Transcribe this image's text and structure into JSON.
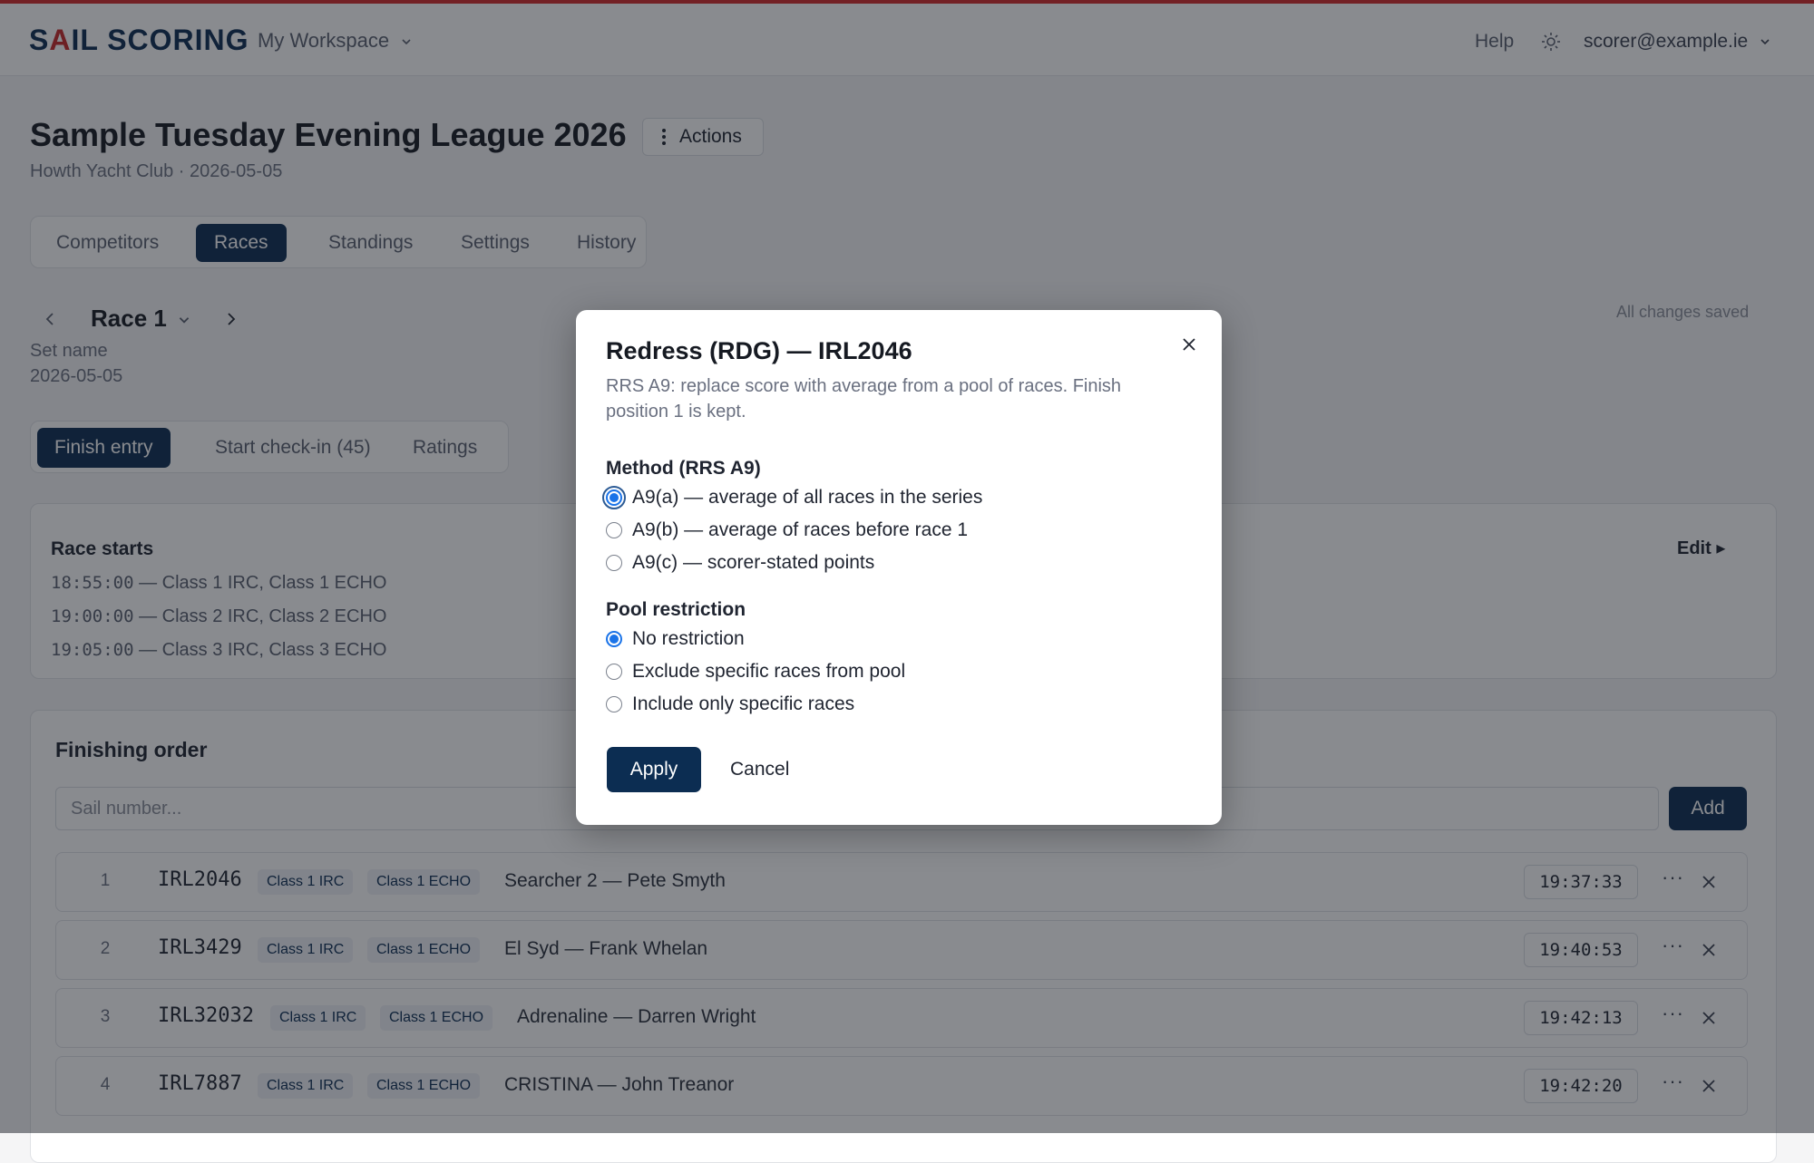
{
  "app": {
    "logo_prefix": "S",
    "logo_accent": "A",
    "logo_rest": "IL SCORING",
    "workspace": "My Workspace",
    "help": "Help",
    "user": "scorer@example.ie",
    "accent_color": "#d32a2a",
    "brand_color": "#0c2d52"
  },
  "event": {
    "title": "Sample Tuesday Evening League 2026",
    "actions_label": "Actions",
    "subtitle": "Howth Yacht Club · 2026-05-05"
  },
  "tabs": [
    {
      "label": "Competitors"
    },
    {
      "label": "Races"
    },
    {
      "label": "Standings"
    },
    {
      "label": "Settings"
    },
    {
      "label": "History"
    }
  ],
  "race": {
    "title": "Race 1",
    "set_name": "Set name",
    "date": "2026-05-05",
    "saved_status": "All changes saved"
  },
  "subtabs": [
    {
      "label": "Finish entry"
    },
    {
      "label": "Start check-in (45)"
    },
    {
      "label": "Ratings"
    }
  ],
  "race_starts": {
    "title": "Race starts",
    "edit_label": "Edit ▸",
    "lines": [
      {
        "time": "18:55:00",
        "classes": " — Class 1 IRC, Class 1 ECHO"
      },
      {
        "time": "19:00:00",
        "classes": " — Class 2 IRC, Class 2 ECHO"
      },
      {
        "time": "19:05:00",
        "classes": " — Class 3 IRC, Class 3 ECHO"
      }
    ]
  },
  "finishing": {
    "title": "Finishing order",
    "placeholder": "Sail number...",
    "add_label": "Add",
    "rows": [
      {
        "pos": "1",
        "sail": "IRL2046",
        "badge1": "Class 1 IRC",
        "badge2": "Class 1 ECHO",
        "boat": "Searcher 2 — Pete Smyth",
        "time": "19:37:33"
      },
      {
        "pos": "2",
        "sail": "IRL3429",
        "badge1": "Class 1 IRC",
        "badge2": "Class 1 ECHO",
        "boat": "El Syd — Frank Whelan",
        "time": "19:40:53"
      },
      {
        "pos": "3",
        "sail": "IRL32032",
        "badge1": "Class 1 IRC",
        "badge2": "Class 1 ECHO",
        "boat": "Adrenaline — Darren Wright",
        "time": "19:42:13"
      },
      {
        "pos": "4",
        "sail": "IRL7887",
        "badge1": "Class 1 IRC",
        "badge2": "Class 1 ECHO",
        "boat": "CRISTINA — John Treanor",
        "time": "19:42:20"
      }
    ]
  },
  "modal": {
    "title": "Redress (RDG) — IRL2046",
    "description": "RRS A9: replace score with average from a pool of races. Finish position 1 is kept.",
    "method_label": "Method (RRS A9)",
    "methods": [
      {
        "label": "A9(a) — average of all races in the series",
        "selected": true
      },
      {
        "label": "A9(b) — average of races before race 1",
        "selected": false
      },
      {
        "label": "A9(c) — scorer-stated points",
        "selected": false
      }
    ],
    "pool_label": "Pool restriction",
    "pools": [
      {
        "label": "No restriction",
        "selected": true
      },
      {
        "label": "Exclude specific races from pool",
        "selected": false
      },
      {
        "label": "Include only specific races",
        "selected": false
      }
    ],
    "apply_label": "Apply",
    "cancel_label": "Cancel"
  }
}
